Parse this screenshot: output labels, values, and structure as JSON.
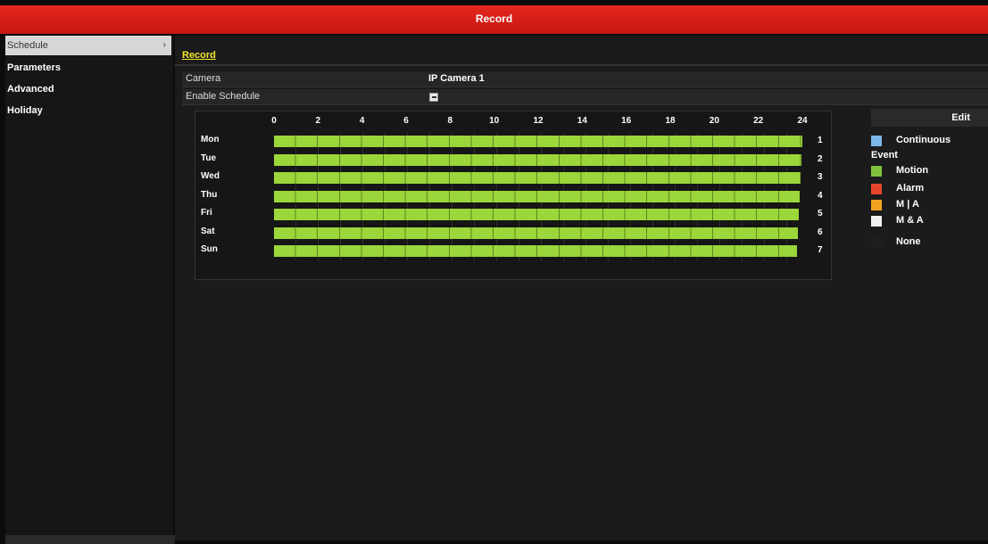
{
  "window": {
    "title": "Record"
  },
  "sidebar": {
    "items": [
      {
        "label": "Schedule",
        "active": true
      },
      {
        "label": "Parameters",
        "active": false
      },
      {
        "label": "Advanced",
        "active": false
      },
      {
        "label": "Holiday",
        "active": false
      }
    ],
    "chevron_icon": "chevron-right-icon"
  },
  "tabs": [
    {
      "label": "Record",
      "active": true
    }
  ],
  "form": {
    "camera_label": "Camera",
    "camera_value": "IP Camera 1",
    "enable_label": "Enable Schedule",
    "enable_checked": true
  },
  "schedule": {
    "hours": [
      "0",
      "2",
      "4",
      "6",
      "8",
      "10",
      "12",
      "14",
      "16",
      "18",
      "20",
      "22",
      "24"
    ],
    "days": [
      {
        "name": "Mon",
        "num": "1",
        "type": "Motion"
      },
      {
        "name": "Tue",
        "num": "2",
        "type": "Motion"
      },
      {
        "name": "Wed",
        "num": "3",
        "type": "Motion"
      },
      {
        "name": "Thu",
        "num": "4",
        "type": "Motion"
      },
      {
        "name": "Fri",
        "num": "5",
        "type": "Motion"
      },
      {
        "name": "Sat",
        "num": "6",
        "type": "Motion"
      },
      {
        "name": "Sun",
        "num": "7",
        "type": "Motion"
      }
    ]
  },
  "legend": {
    "edit_label": "Edit",
    "continuous": {
      "label": "Continuous",
      "color": "#7bb7ea"
    },
    "event_label": "Event",
    "events": [
      {
        "label": "Motion",
        "color": "#7ec23d"
      },
      {
        "label": "Alarm",
        "color": "#e8462a"
      },
      {
        "label": "M | A",
        "color": "#f0a522"
      },
      {
        "label": "M & A",
        "color": "#f2f2f2"
      }
    ],
    "none": {
      "label": "None",
      "color": "#1e1e1e"
    }
  }
}
